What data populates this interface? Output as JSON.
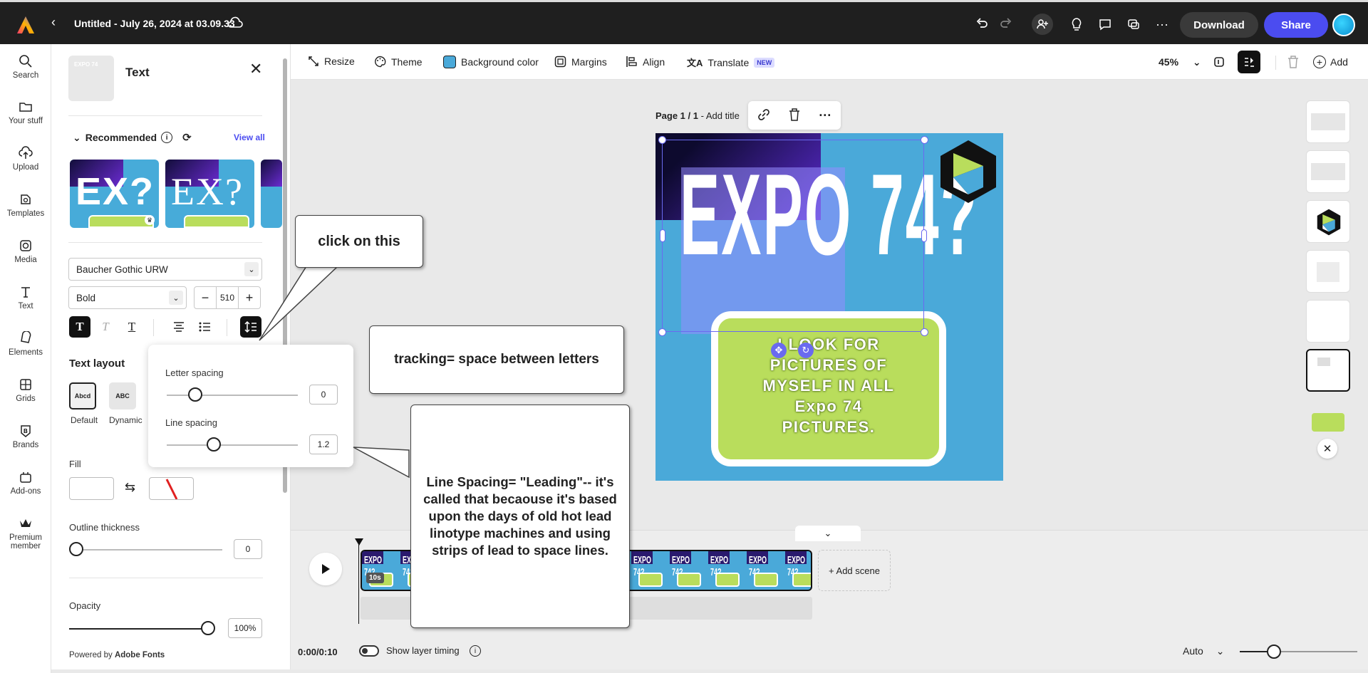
{
  "app": {
    "doc_title": "Untitled - July 26, 2024 at 03.09.33",
    "download_label": "Download",
    "share_label": "Share",
    "brand_color": "#4b4cf0"
  },
  "rail": {
    "items": [
      {
        "label": "Search",
        "icon": "search-icon"
      },
      {
        "label": "Your stuff",
        "icon": "folder-icon"
      },
      {
        "label": "Upload",
        "icon": "upload-icon"
      },
      {
        "label": "Templates",
        "icon": "templates-icon"
      },
      {
        "label": "Media",
        "icon": "media-icon"
      },
      {
        "label": "Text",
        "icon": "text-icon"
      },
      {
        "label": "Elements",
        "icon": "elements-icon"
      },
      {
        "label": "Grids",
        "icon": "grid-icon"
      },
      {
        "label": "Brands",
        "icon": "brand-icon"
      },
      {
        "label": "Add-ons",
        "icon": "addons-icon"
      },
      {
        "label": "Premium member",
        "icon": "crown-icon"
      }
    ]
  },
  "panel": {
    "title": "Text",
    "recommended_label": "Recommended",
    "view_all_label": "View all",
    "font_family": "Baucher Gothic URW",
    "font_weight": "Bold",
    "font_size": "510",
    "text_layout_title": "Text layout",
    "layout_default_label": "Default",
    "layout_dynamic_label": "Dynamic",
    "layout_default_preview": "Abcd",
    "layout_dynamic_preview": "ABC",
    "fill_label": "Fill",
    "outline_label": "Outline thickness",
    "outline_value": "0",
    "opacity_label": "Opacity",
    "opacity_value": "100%",
    "powered_by": "Powered by",
    "powered_by_brand": "Adobe Fonts"
  },
  "toolbar": {
    "resize": "Resize",
    "theme": "Theme",
    "background_color": "Background color",
    "margins": "Margins",
    "align": "Align",
    "translate": "Translate",
    "new_badge": "NEW",
    "zoom": "45%",
    "add": "Add"
  },
  "canvas": {
    "page_label": "Page 1 / 1",
    "add_title": " - Add title",
    "headline": "EXPO 74?",
    "body_text": [
      "I LOOK FOR",
      "PICTURES OF",
      "MYSELF IN ALL",
      "Expo 74",
      "PICTURES."
    ]
  },
  "spacing": {
    "letter_spacing_label": "Letter spacing",
    "letter_spacing_value": "0",
    "letter_spacing_level": 0.22,
    "line_spacing_label": "Line spacing",
    "line_spacing_value": "1.2",
    "line_spacing_level": 0.36
  },
  "timeline": {
    "duration_badge": "10s",
    "add_scene": "+ Add scene",
    "time": "0:00/0:10",
    "show_layer_timing": "Show layer timing",
    "playback": "Auto"
  },
  "callouts": {
    "click": "click on this",
    "tracking": "tracking= space between letters",
    "leading": "Line Spacing= \"Leading\"-- it's called that becaouse it's based upon the days of old hot lead linotype machines and using strips of lead to space lines."
  }
}
